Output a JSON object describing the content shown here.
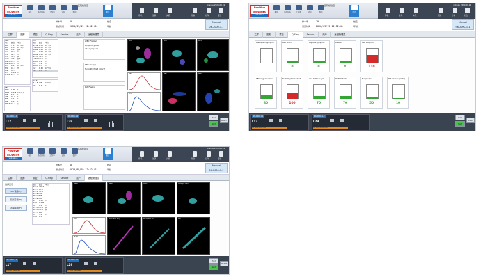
{
  "app": {
    "logo_line1": "Positive",
    "logo_line2": "Validation",
    "window_title": "医院检验室",
    "status_right": "pdsnpu 2020-09-19",
    "toolbar": [
      {
        "label": "报告",
        "icon": "report-icon"
      },
      {
        "label": "质控分析",
        "icon": "qc-icon"
      },
      {
        "label": "工作单",
        "icon": "worklist-icon"
      },
      {
        "label": "试剂",
        "icon": "reagent-icon"
      },
      {
        "label": "维护",
        "icon": "maintenance-icon"
      },
      {
        "label": "统计",
        "icon": "stats-icon"
      }
    ],
    "dark_toolbar": [
      "停机",
      "注销",
      "关机",
      "帮助",
      "打印",
      "报告"
    ]
  },
  "sample": {
    "id_label": "样本号",
    "id_value": "10",
    "time_label": "测试时间",
    "time_value": "2020/09/19 12:52:41",
    "mode_label": "Manual",
    "mode_value": "06-2000-1-1",
    "patient_label": "姓名",
    "patient_value": "",
    "age_label": "年龄",
    "age_value": ""
  },
  "tabs": [
    "主屏",
    "图形",
    "重复",
    "Q-Flag",
    "Service",
    "用户",
    "远程管理员"
  ],
  "cbc": {
    "header": "CBC",
    "col_headers": [
      "项目",
      "数值",
      "单位"
    ],
    "rows": [
      [
        "WBC",
        "7.0",
        "10^9/L"
      ],
      [
        "RBC",
        "4.55",
        "10^12/L"
      ],
      [
        "HGB",
        "140",
        "g/L"
      ],
      [
        "HCT",
        "40.2",
        "%"
      ],
      [
        "MCV",
        "88.3",
        "fL"
      ],
      [
        "MCH",
        "30.8",
        "pg"
      ],
      [
        "MCHC",
        "348",
        "g/L"
      ],
      [
        "RDW-CV",
        "12.9",
        "%"
      ],
      [
        "RDW-SD",
        "42.0",
        "fL"
      ],
      [
        "PLT",
        "220",
        "10^9/L"
      ],
      [
        "MPV",
        "10.1",
        "fL"
      ],
      [
        "PDW",
        "16.2",
        ""
      ],
      [
        "PCT",
        "0.222",
        "%"
      ],
      [
        "P-LCR",
        "24.5",
        "%"
      ]
    ]
  },
  "diff": {
    "header": "DIFF",
    "col_headers": [
      "项目",
      "数值",
      "单位"
    ],
    "rows": [
      [
        "NEUT#",
        "4.12",
        "10^9/L"
      ],
      [
        "LYMPH#",
        "2.10",
        "10^9/L"
      ],
      [
        "MONO#",
        "0.45",
        "10^9/L"
      ],
      [
        "EO#",
        "0.25",
        "10^9/L"
      ],
      [
        "BASO#",
        "0.05",
        "10^9/L"
      ],
      [
        "NEUT%",
        "59.0",
        "%"
      ],
      [
        "LYMPH%",
        "30.0",
        "%"
      ],
      [
        "MONO%",
        "6.4",
        "%"
      ],
      [
        "EO%",
        "3.6",
        "%"
      ],
      [
        "BASO%",
        "0.7",
        "%"
      ],
      [
        "IG#",
        "0.02",
        "10^9/L"
      ],
      [
        "IG%",
        "0.3",
        "%"
      ]
    ]
  },
  "ret": {
    "header": "RET",
    "rows": [
      [
        "RET%",
        "1.05",
        "%"
      ],
      [
        "RET#",
        "0.048",
        "10^12/L"
      ],
      [
        "IRF",
        "8.2",
        "%"
      ],
      [
        "LFR",
        "91.8",
        "%"
      ],
      [
        "MFR",
        "7.3",
        "%"
      ],
      [
        "HFR",
        "0.9",
        "%"
      ],
      [
        "RET-He",
        "33.1",
        "pg"
      ]
    ]
  },
  "pltf": {
    "header": "PLT-F",
    "rows": [
      [
        "PLT-F",
        "225",
        "10^9/L"
      ],
      [
        "IPF",
        "3.6",
        "%"
      ]
    ]
  },
  "flags": {
    "wbc_title": "WBC Flag(s)",
    "wbc_items": [
      "Lymphocytosis",
      "Abn Lympho?"
    ],
    "rbc_title": "RBC Flag(s)",
    "rbc_items": [
      "Turbidity/HGB Interf?"
    ],
    "plt_title": "PLT Flag(s)",
    "plt_items": []
  },
  "scatter_labels": {
    "s1": [
      "WDF",
      "WDF",
      "WPC"
    ],
    "s1b": [
      "RBC",
      "RET",
      "PLT-F"
    ],
    "s3": [
      "WNR",
      "WDF",
      "WPC",
      "WDF(SS-FSC)"
    ],
    "s3b": [
      "RBC",
      "WDF(SS-FSC)",
      "WPC(SS-FSC)",
      "RET"
    ]
  },
  "qflag": {
    "tiles": [
      {
        "title": "Blasts/Abn Lympho?",
        "value": "",
        "level": 0,
        "color": "#a7a7a7"
      },
      {
        "title": "Left Shift?",
        "value": "0",
        "level": 0.08,
        "color": "#33a634"
      },
      {
        "title": "Atypical Lympho?",
        "value": "0",
        "level": 0.08,
        "color": "#33a634"
      },
      {
        "title": "Blasts?",
        "value": "0",
        "level": 0.08,
        "color": "#33a634"
      },
      {
        "title": "Abn Lympho?",
        "value": "110",
        "level": 0.55,
        "color": "#d42a2a"
      },
      {
        "title": "RBC Agglutination?",
        "value": "80",
        "level": 0.25,
        "color": "#33a634"
      },
      {
        "title": "Turbidity/HGB Interf?",
        "value": "100",
        "level": 0.45,
        "color": "#d42a2a"
      },
      {
        "title": "Iron Deficiency?",
        "value": "70",
        "level": 0.2,
        "color": "#33a634"
      },
      {
        "title": "HGB Defect?",
        "value": "70",
        "level": 0.2,
        "color": "#33a634"
      },
      {
        "title": "Fragments?",
        "value": "50",
        "level": 0.15,
        "color": "#33a634"
      },
      {
        "title": "PLT Clumps?(WDF)",
        "value": "10",
        "level": 0.05,
        "color": "#33a634"
      }
    ]
  },
  "screen3": {
    "left_title": "选择显示",
    "left_buttons": [
      "PLT专用(F)",
      "双联专用(R)",
      "双联专用(F)"
    ],
    "table_header": [
      "项目",
      "数值",
      "单位"
    ],
    "rows": [
      [
        "NEU-X",
        "345.8",
        ""
      ],
      [
        "NEU-Y",
        "40.3",
        ""
      ],
      [
        "NEU-Z",
        "58.4",
        ""
      ],
      [
        "NEU-WX",
        "302",
        ""
      ],
      [
        "NEU-WY",
        "598",
        ""
      ],
      [
        "NEU-WZ",
        "661",
        ""
      ],
      [
        "RET",
        "1.05",
        "%"
      ],
      [
        "RET#",
        "0.048",
        ""
      ],
      [
        "IRF",
        "8.2",
        "%"
      ],
      [
        "RET-He",
        "33.1",
        "pg"
      ],
      [
        "RBC-He",
        "31.5",
        "pg"
      ],
      [
        "PLT-F",
        "225",
        ""
      ],
      [
        "IPF",
        "3.6",
        "%"
      ],
      [
        "IPF#",
        "8.1",
        ""
      ]
    ]
  },
  "bottom": {
    "panel1_id": "06-2000-1-1",
    "panel1_num": "L17",
    "panel1_bar": "CV DATA RECEIVED",
    "panel2_id": "06-2000-1-2",
    "panel2_num": "L29",
    "panel2_bar": "CV DATA RECEIVED",
    "right_btns": [
      "Hold",
      "Start",
      "WSSET"
    ]
  }
}
